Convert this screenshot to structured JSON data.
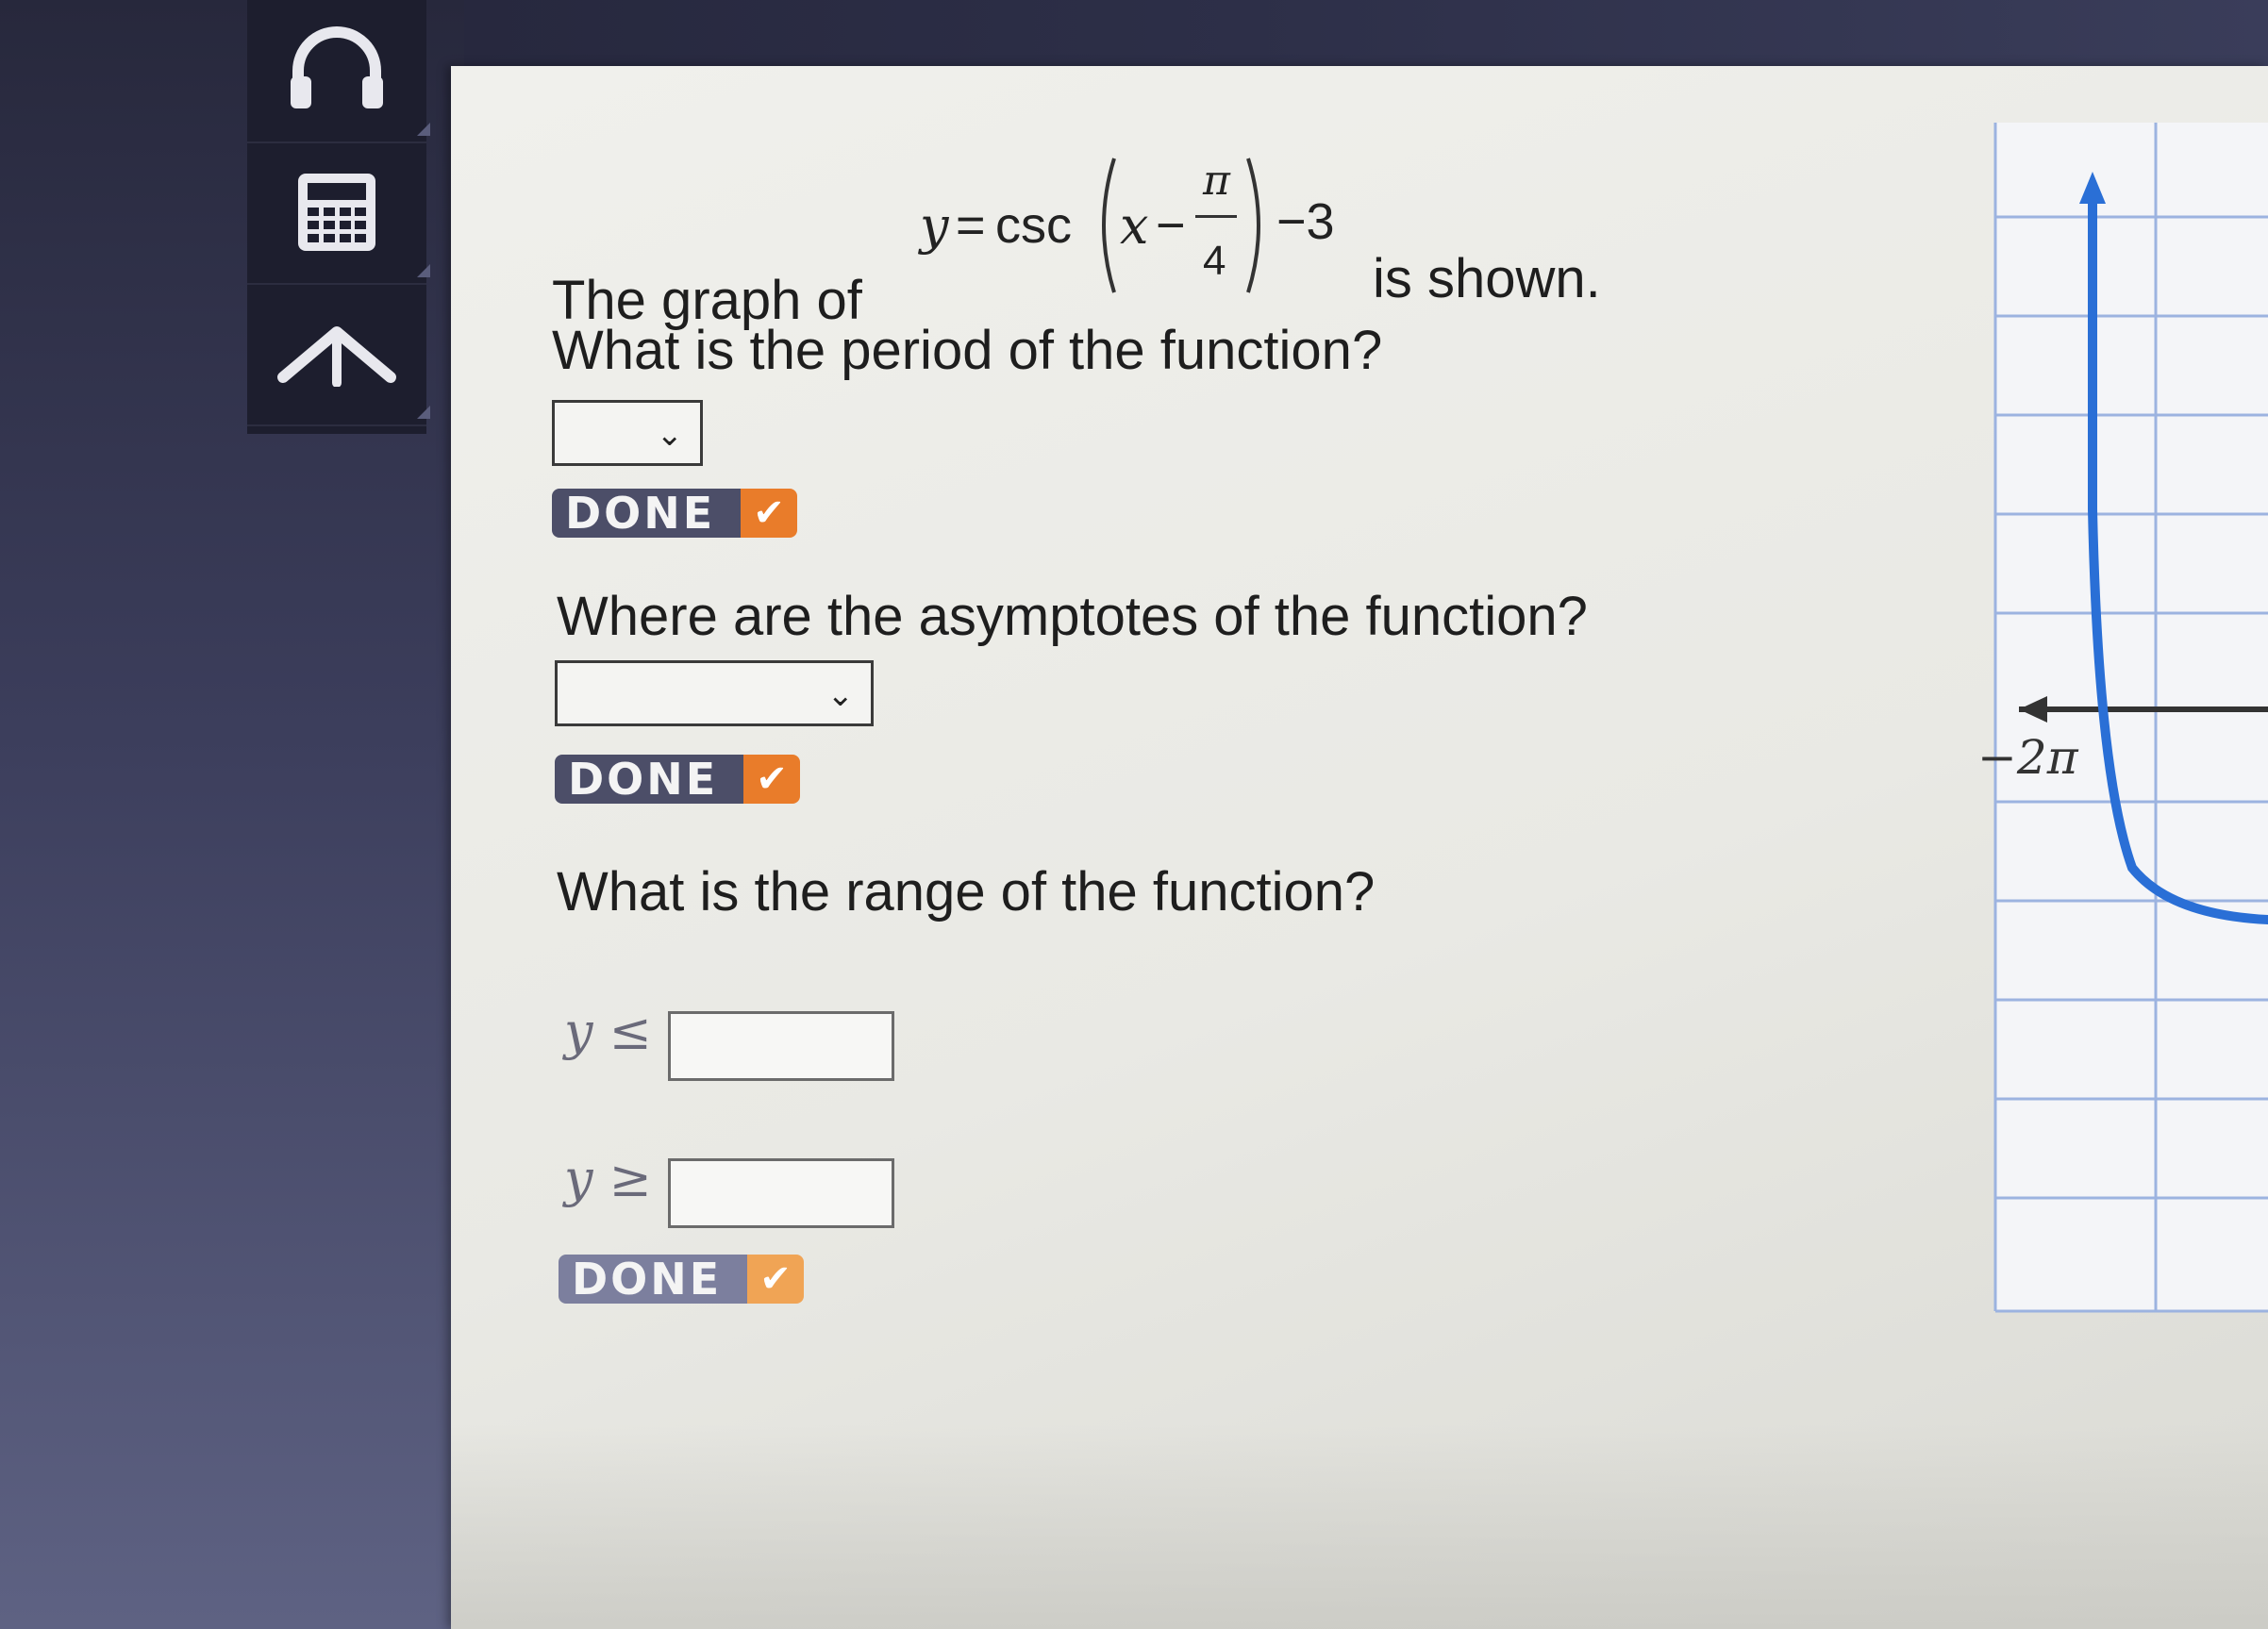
{
  "toolbar": {
    "items": [
      {
        "icon": "headphones-icon"
      },
      {
        "icon": "calculator-icon"
      },
      {
        "icon": "caret-up-icon"
      }
    ]
  },
  "question": {
    "intro_prefix": "The graph of",
    "intro_suffix": "is shown.",
    "formula": {
      "lhs": "y",
      "eq": "=",
      "func": "csc",
      "var": "x",
      "minus": "−",
      "frac_num": "π",
      "frac_den": "4",
      "tail": "−3"
    }
  },
  "period": {
    "prompt": "What is the period of the function?",
    "selected": "",
    "done_label": "DONE"
  },
  "asymptotes": {
    "prompt": "Where are the asymptotes of the function?",
    "selected": "",
    "done_label": "DONE"
  },
  "range": {
    "prompt": "What is the range of the function?",
    "le_label": "y ≤",
    "ge_label": "y ≥",
    "le_value": "",
    "ge_value": "",
    "done_label": "DONE"
  },
  "graph": {
    "x_tick_label": "−2π",
    "curve_color": "#2a6fd6",
    "grid_color": "#9cb3e0"
  }
}
